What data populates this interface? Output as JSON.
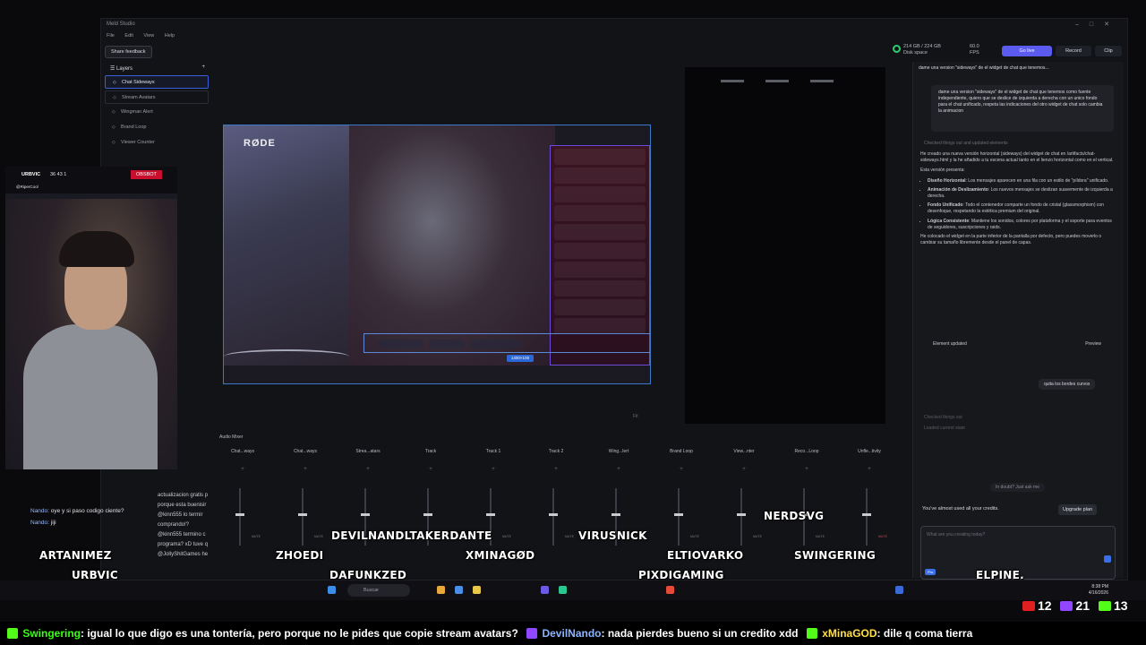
{
  "window": {
    "app_title": "Meld Studio",
    "menu": [
      "File",
      "Edit",
      "View",
      "Help"
    ],
    "share_feedback": "Share feedback"
  },
  "top_stats": {
    "disk_value": "214 GB / 224 GB",
    "disk_label": "Disk space",
    "fps_value": "60.0",
    "fps_label": "FPS",
    "go_live": "Go live",
    "record": "Record",
    "clip": "Clip"
  },
  "layers": {
    "title": "Layers",
    "items": [
      {
        "label": "Chat Sideways"
      },
      {
        "label": "Stream Avatars"
      },
      {
        "label": "Wingman Alert"
      },
      {
        "label": "Brand Loop"
      },
      {
        "label": "Viewer Counter"
      }
    ]
  },
  "canvas": {
    "brand": "RØDE",
    "size_badge": "1400×100",
    "zoom": "Fit"
  },
  "ai_panel": {
    "title": "dame una version \"sideways\" de el widget de chat que tenemos...",
    "user_msg": "dame una version \"sideways\" de el widget de chat que tenemos como fuente independiente, quiero que se deslice de izquierda a derecha con un unico fondo para el chat unificado, respeta las indicaciones del otro widget de chat solo cambia la animacion",
    "checked_things": "Checked things out and updated elements",
    "intro": "He creado una nueva versión horizontal (sideways) del widget de chat en /artifacts/chat-sideways.html y la he añadido a tu escena actual tanto en el lienzo horizontal como en el vertical.",
    "features_label": "Esta versión presenta:",
    "features": [
      {
        "title": "Diseño Horizontal",
        "text": ": Los mensajes aparecen en una fila con un estilo de \"píldora\" unificado."
      },
      {
        "title": "Animación de Deslizamiento",
        "text": ": Los nuevos mensajes se deslizan suavemente de izquierda a derecha."
      },
      {
        "title": "Fondo Unificado",
        "text": ": Todo el contenedor comparte un fondo de cristal (glassmorphism) con desenfoque, respetando la estética premium del original."
      },
      {
        "title": "Lógica Consistente",
        "text": ": Mantiene los sonidos, colores por plataforma y el soporte para eventos de seguidores, suscripciones y raids."
      }
    ],
    "outro": "He colocado el widget en la parte inferior de la pantalla por defecto, pero puedes moverlo o cambiar su tamaño libremente desde el panel de capas.",
    "element_updated": "Element updated",
    "preview": "Preview",
    "user_msg2": "quita los bordes curvos",
    "checked_out": "Checked things out",
    "loaded_scene": "Loaded current state",
    "in_doubt": "In doubt? Just ask me",
    "credits_warning": "You've almost used all your credits.",
    "upgrade": "Upgrade plan",
    "prompt_placeholder": "What are you creating today?",
    "prompt_tag": "Pro"
  },
  "mixer": {
    "title": "Audio Mixer",
    "channels": [
      "Chat...ways",
      "Chat...ways",
      "Strea...atars",
      "Track",
      "Track 1",
      "Track 2",
      "Wing...lert",
      "Brand Loop",
      "View...nter",
      "Reco...Loop",
      "Unfle...tivity"
    ]
  },
  "webcam": {
    "channel": "URBVIC",
    "stats": "36  43  1",
    "obsbot": "OBSBOT",
    "handle": "@RiperCool"
  },
  "stream_chat": [
    {
      "user": "Nando",
      "text": ": oye y si paso codigo ciente?"
    },
    {
      "user": "Nando",
      "text": ": jiji"
    }
  ],
  "stream_chat_side": [
    "actualizacion gratis p",
    "porque esta buenisir",
    "@kinn555 lo termir",
    "comprando!?",
    "@kinn555 termino c",
    "programa? xD tuve q",
    "@JollyShitGames he"
  ],
  "viewer_names": {
    "n1": "ARTANIMEZ",
    "n2": "URBVIC",
    "n3": "ZHOEDI",
    "n4": "DEVILNANDLTAKERDANTE",
    "n5": "DAFUNKZED",
    "n6": "XMINAGØD",
    "n7": "VIRUSNICK",
    "n8": "PIXDIGAMING",
    "n9": "ELTIOVARKO",
    "n10": "NERDSVG",
    "n11": "SWINGERING",
    "n12": "ELPINE."
  },
  "taskbar": {
    "search": "Buscar",
    "time": "8:38 PM",
    "date": "4/16/2026"
  },
  "counts": {
    "youtube": "12",
    "twitch": "21",
    "kick": "13"
  },
  "ticker": {
    "u1": "Swingering",
    "m1": ": igual lo que digo es una tontería, pero porque no le pides que copie stream avatars?",
    "u2": "DevilNando",
    "m2": ": nada pierdes bueno si un credito xdd",
    "u3": "xMinaGOD",
    "m3": ": dile q coma tierra"
  },
  "colors": {
    "accent": "#5b5bf0",
    "selection": "#3b5fd8",
    "obsbot": "#c8102e",
    "disk_ok": "#2ecc71"
  }
}
